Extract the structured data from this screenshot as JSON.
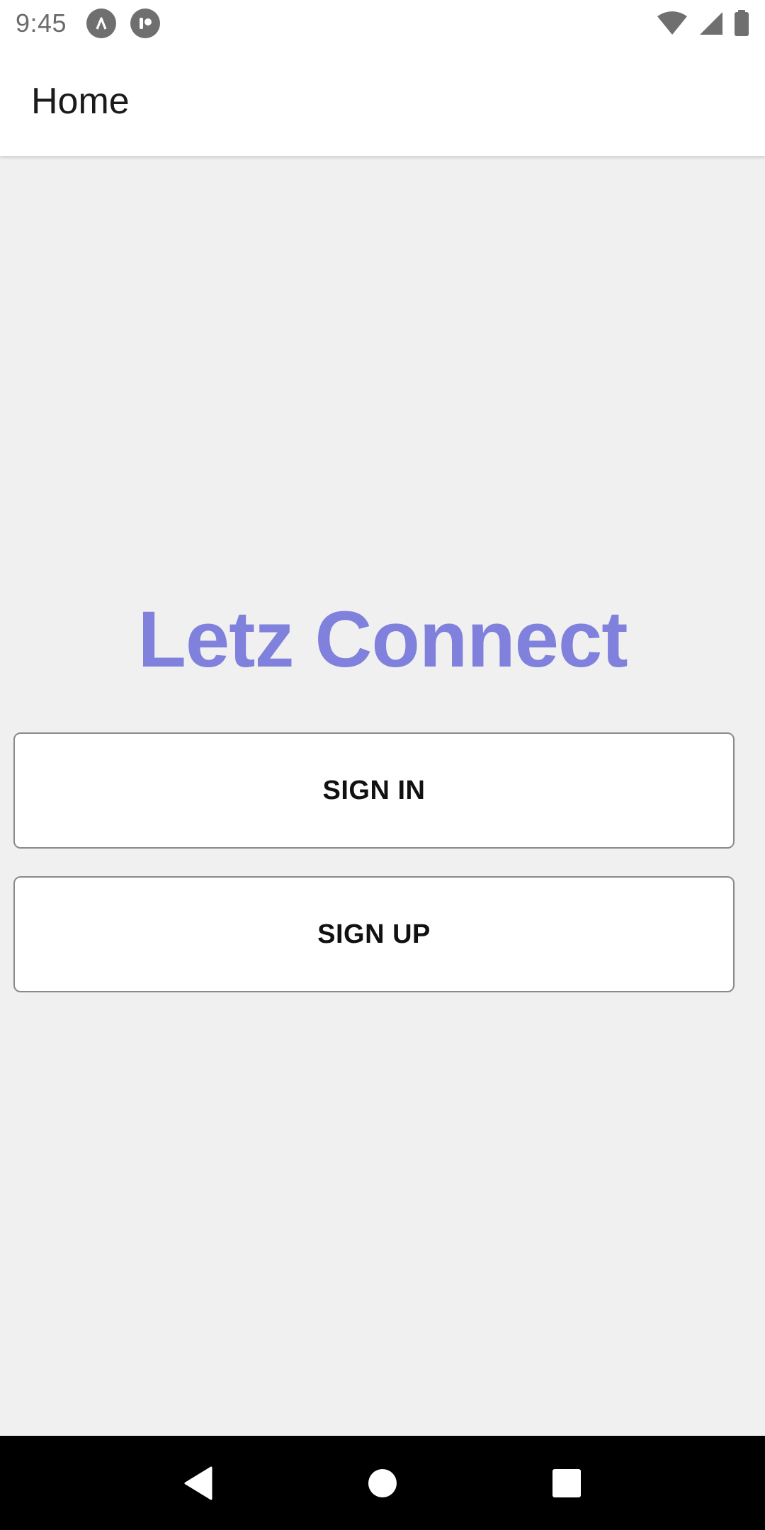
{
  "status_bar": {
    "time": "9:45",
    "left_icons": [
      "notification-a-icon",
      "notification-b-icon"
    ],
    "right_icons": [
      "wifi-icon",
      "signal-icon",
      "battery-icon"
    ]
  },
  "app_bar": {
    "title": "Home"
  },
  "main": {
    "brand_title": "Letz Connect",
    "sign_in_label": "SIGN IN",
    "sign_up_label": "SIGN UP"
  },
  "nav_bar": {
    "icons": [
      "back-icon",
      "home-icon",
      "recents-icon"
    ]
  },
  "colors": {
    "brand": "#8080dd",
    "background": "#f0f0f0",
    "surface": "#ffffff",
    "nav_bar": "#000000"
  }
}
